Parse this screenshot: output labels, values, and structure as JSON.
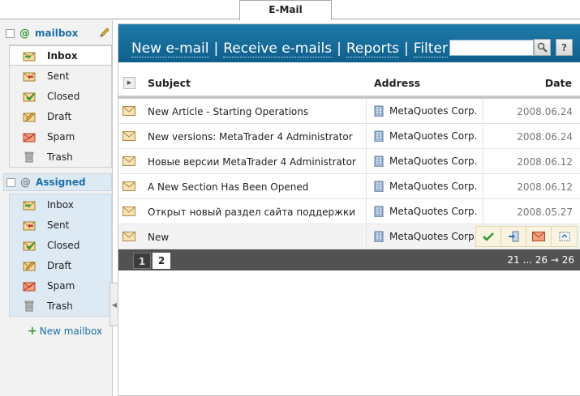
{
  "tab": {
    "title": "E-Mail"
  },
  "sidebar": {
    "mailboxes": [
      {
        "name": "mailbox",
        "folders": [
          {
            "label": "Inbox",
            "icon": "inbox-icon",
            "active": true
          },
          {
            "label": "Sent",
            "icon": "sent-icon"
          },
          {
            "label": "Closed",
            "icon": "closed-icon"
          },
          {
            "label": "Draft",
            "icon": "draft-icon"
          },
          {
            "label": "Spam",
            "icon": "spam-icon"
          },
          {
            "label": "Trash",
            "icon": "trash-icon"
          }
        ]
      },
      {
        "name": "Assigned",
        "folders": [
          {
            "label": "Inbox",
            "icon": "inbox-icon"
          },
          {
            "label": "Sent",
            "icon": "sent-icon"
          },
          {
            "label": "Closed",
            "icon": "closed-icon"
          },
          {
            "label": "Draft",
            "icon": "draft-icon"
          },
          {
            "label": "Spam",
            "icon": "spam-icon"
          },
          {
            "label": "Trash",
            "icon": "trash-icon"
          }
        ]
      }
    ],
    "new_mailbox_label": "New mailbox"
  },
  "toolbar": {
    "links": [
      "New e-mail",
      "Receive e-mails",
      "Reports",
      "Filter"
    ],
    "separator": "|",
    "search_placeholder": "",
    "search_button_icon": "search-icon",
    "help_label": "?"
  },
  "table": {
    "columns": {
      "subject": "Subject",
      "address": "Address",
      "date": "Date"
    },
    "rows": [
      {
        "subject": "New Article - Starting Operations",
        "address": "MetaQuotes Corp.",
        "date": "2008.06.24"
      },
      {
        "subject": "New versions: MetaTrader 4 Administrator",
        "address": "MetaQuotes Corp.",
        "date": "2008.06.24"
      },
      {
        "subject": "Новые версии MetaTrader 4 Administrator",
        "address": "MetaQuotes Corp.",
        "date": "2008.06.12"
      },
      {
        "subject": "A New Section Has Been Opened",
        "address": "MetaQuotes Corp.",
        "date": "2008.06.12"
      },
      {
        "subject": "Открыт новый раздел сайта поддержки",
        "address": "MetaQuotes Corp.",
        "date": "2008.05.27"
      },
      {
        "subject": "New",
        "address": "MetaQuotes Corp.",
        "date": ""
      }
    ]
  },
  "pager": {
    "pages": [
      "1",
      "2"
    ],
    "current": "2",
    "range": "21 ... 26 → 26"
  },
  "colors": {
    "toolbar_blue": "#1a6f9e",
    "link_blue": "#1a70a8",
    "accent_green": "#3b9a3b",
    "pager_gray": "#525252"
  }
}
